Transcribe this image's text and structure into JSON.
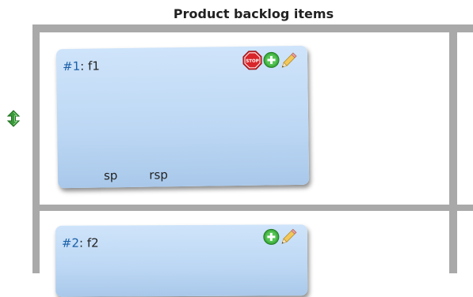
{
  "column": {
    "header": "Product backlog items"
  },
  "colors": {
    "card_top": "#cfe4fa",
    "card_bottom": "#a9c8ea",
    "board_line": "#a9a9a9",
    "id_link": "#1a5fa8",
    "stop_red": "#d8262a",
    "add_green": "#3fae3f",
    "handle_green": "#2e9b2e"
  },
  "icons": {
    "drag_handle": "up-down-arrow-icon",
    "stop": "stop-sign-icon",
    "add": "plus-circle-icon",
    "edit": "pencil-icon"
  },
  "cards": [
    {
      "id": "#1",
      "separator": ": ",
      "title": "f1",
      "stop_text": "STOP",
      "sp_label": "sp",
      "rsp_label": "rsp"
    },
    {
      "id": "#2",
      "separator": ": ",
      "title": "f2"
    }
  ]
}
